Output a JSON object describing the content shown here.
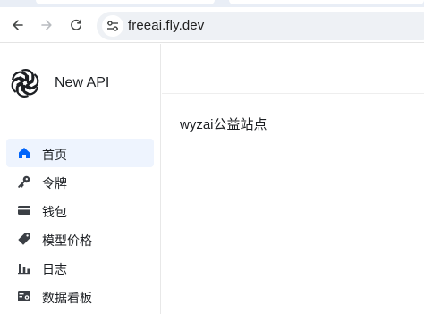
{
  "browser": {
    "url": "freeai.fly.dev",
    "icons": {
      "back": "back-arrow-icon",
      "forward": "forward-arrow-icon",
      "reload": "reload-icon",
      "site_info": "site-settings-icon"
    }
  },
  "app": {
    "name": "New API",
    "logo": "openai-logo",
    "accent_color": "#0064fa"
  },
  "sidebar": {
    "items": [
      {
        "label": "首页",
        "icon": "home-icon",
        "active": true
      },
      {
        "label": "令牌",
        "icon": "key-icon",
        "active": false
      },
      {
        "label": "钱包",
        "icon": "wallet-icon",
        "active": false
      },
      {
        "label": "模型价格",
        "icon": "price-tag-icon",
        "active": false
      },
      {
        "label": "日志",
        "icon": "bar-chart-icon",
        "active": false
      },
      {
        "label": "数据看板",
        "icon": "dashboard-icon",
        "active": false
      }
    ]
  },
  "main": {
    "title": "wyzai公益站点"
  }
}
